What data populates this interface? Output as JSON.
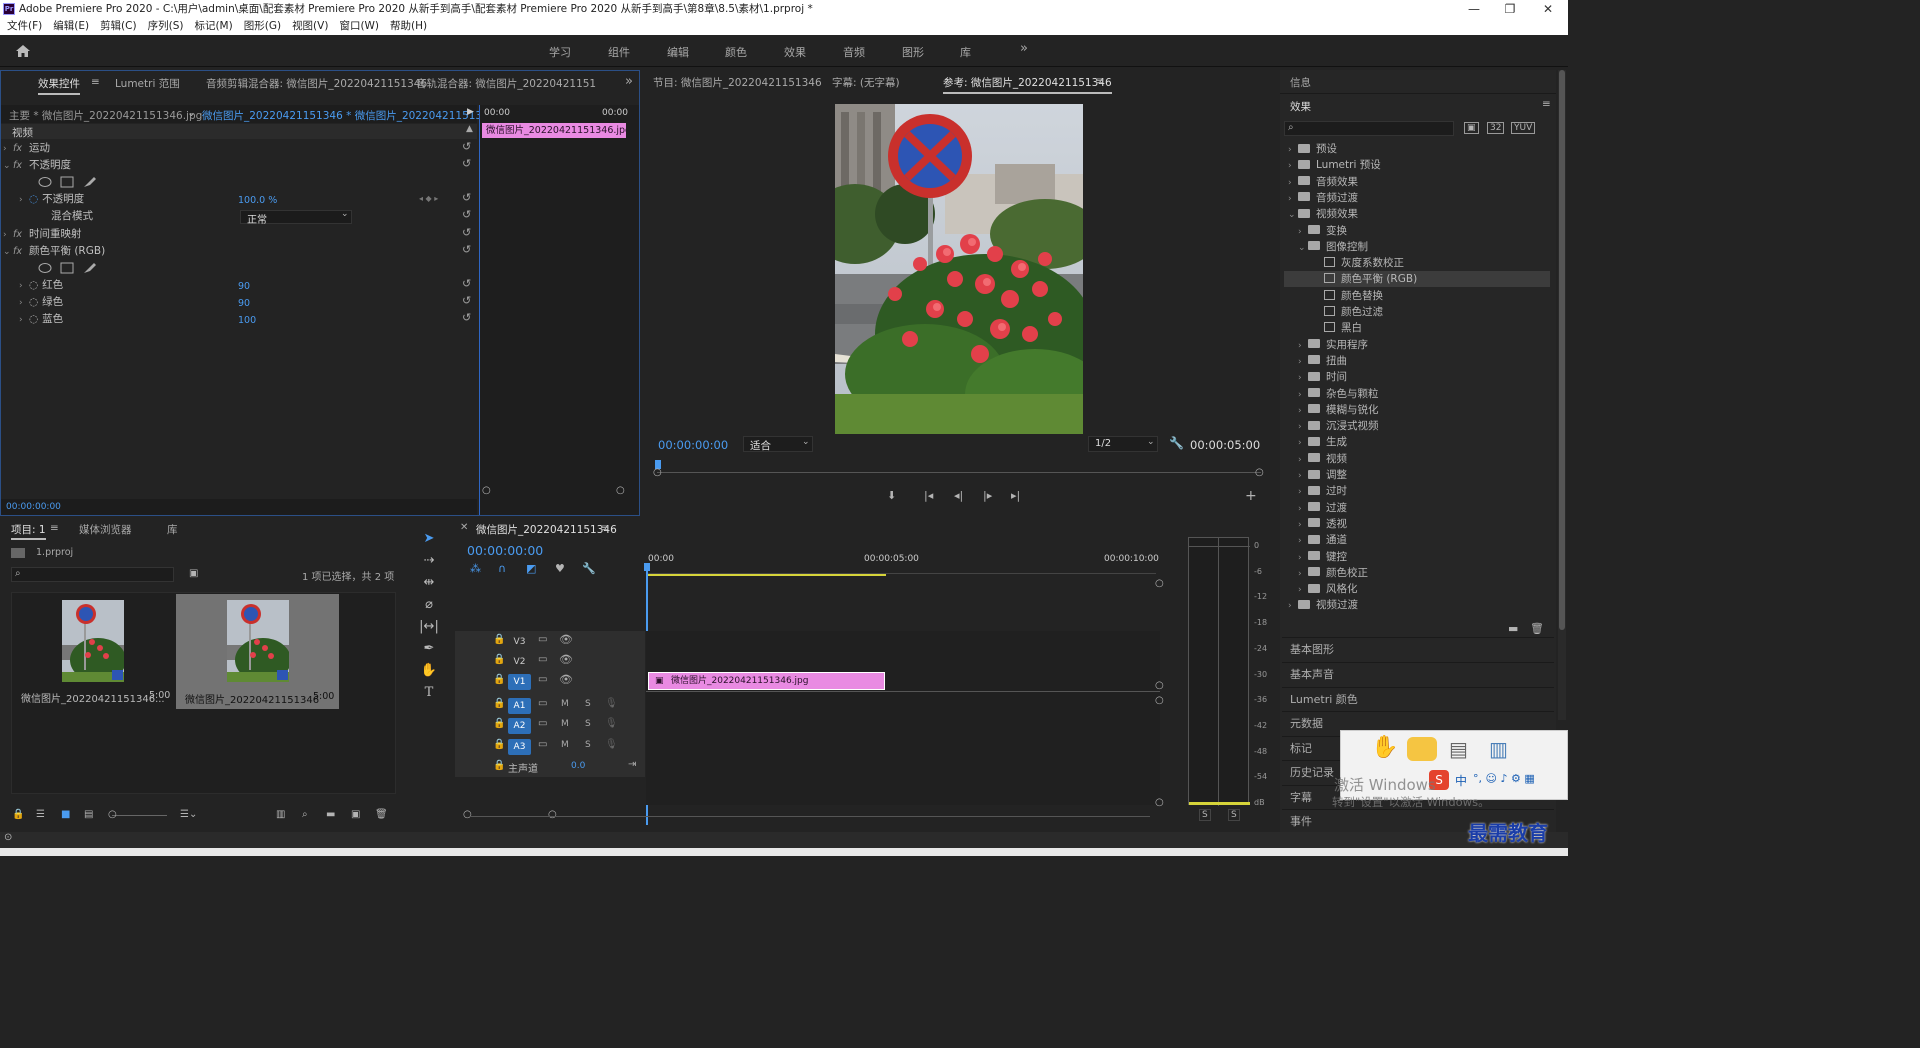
{
  "window": {
    "title": "Adobe Premiere Pro 2020 - C:\\用户\\admin\\桌面\\配套素材 Premiere Pro 2020 从新手到高手\\配套素材 Premiere Pro 2020 从新手到高手\\第8章\\8.5\\素材\\1.prproj *",
    "min": "—",
    "max": "❐",
    "close": "✕"
  },
  "menu": [
    "文件(F)",
    "编辑(E)",
    "剪辑(C)",
    "序列(S)",
    "标记(M)",
    "图形(G)",
    "视图(V)",
    "窗口(W)",
    "帮助(H)"
  ],
  "workspaces": [
    "学习",
    "组件",
    "编辑",
    "颜色",
    "效果",
    "音频",
    "图形",
    "库"
  ],
  "ws_more": "»",
  "left_tabs": [
    "效果控件",
    "Lumetri 范围",
    "音频剪辑混合器: 微信图片_20220421151346",
    "音轨混合器: 微信图片_20220421151"
  ],
  "effect_controls": {
    "master": "主要 * 微信图片_20220421151346.jpg",
    "sequence": "微信图片_20220421151346 * 微信图片_20220421151346...",
    "time_start": "00:00",
    "time_end": "00:00",
    "clip": "微信图片_20220421151346.jpg",
    "section": "视频",
    "rows": [
      "运动",
      "不透明度",
      "不透明度",
      "混合模式",
      "时间重映射",
      "颜色平衡 (RGB)",
      "红色",
      "绿色",
      "蓝色"
    ],
    "opacity_value": "100.0 %",
    "blend_value": "正常",
    "red": "90",
    "green": "90",
    "blue": "100",
    "footer_time": "00:00:00:00"
  },
  "monitor": {
    "tabs": [
      "节目: 微信图片_20220421151346",
      "字幕: (无字幕)",
      "参考: 微信图片_20220421151346"
    ],
    "timecode": "00:00:00:00",
    "fit": "适合",
    "quality": "1/2",
    "duration": "00:00:05:00"
  },
  "project": {
    "tabs": [
      "项目: 1",
      "媒体浏览器",
      "库"
    ],
    "file": "1.prproj",
    "selection": "1 项已选择，共 2 项",
    "items": [
      {
        "name": "微信图片_20220421151346...",
        "duration": "5:00"
      },
      {
        "name": "微信图片_20220421151346",
        "duration": "5:00"
      }
    ]
  },
  "timeline": {
    "title": "微信图片_20220421151346",
    "timecode": "00:00:00:00",
    "ruler": [
      "00:00",
      "00:00:05:00",
      "00:00:10:00"
    ],
    "tracks": [
      "V3",
      "V2",
      "V1",
      "A1",
      "A2",
      "A3"
    ],
    "master": "主声道",
    "master_value": "0.0",
    "clip": "微信图片_20220421151346.jpg"
  },
  "meter": {
    "labels": [
      "0",
      "-6",
      "-12",
      "-18",
      "-24",
      "-30",
      "-36",
      "-42",
      "-48",
      "-54",
      "dB"
    ],
    "solo": "S"
  },
  "right": {
    "info": "信息",
    "effects": "效果",
    "tree": [
      {
        "label": "预设",
        "level": 0,
        "open": false
      },
      {
        "label": "Lumetri 预设",
        "level": 0,
        "open": false
      },
      {
        "label": "音频效果",
        "level": 0,
        "open": false
      },
      {
        "label": "音频过渡",
        "level": 0,
        "open": false
      },
      {
        "label": "视频效果",
        "level": 0,
        "open": true
      },
      {
        "label": "变换",
        "level": 1,
        "open": false
      },
      {
        "label": "图像控制",
        "level": 1,
        "open": true
      },
      {
        "label": "灰度系数校正",
        "level": 2,
        "open": false
      },
      {
        "label": "颜色平衡 (RGB)",
        "level": 2,
        "open": false
      },
      {
        "label": "颜色替换",
        "level": 2,
        "open": false
      },
      {
        "label": "颜色过滤",
        "level": 2,
        "open": false
      },
      {
        "label": "黑白",
        "level": 2,
        "open": false
      },
      {
        "label": "实用程序",
        "level": 1,
        "open": false
      },
      {
        "label": "扭曲",
        "level": 1,
        "open": false
      },
      {
        "label": "时间",
        "level": 1,
        "open": false
      },
      {
        "label": "杂色与颗粒",
        "level": 1,
        "open": false
      },
      {
        "label": "模糊与锐化",
        "level": 1,
        "open": false
      },
      {
        "label": "沉浸式视频",
        "level": 1,
        "open": false
      },
      {
        "label": "生成",
        "level": 1,
        "open": false
      },
      {
        "label": "视频",
        "level": 1,
        "open": false
      },
      {
        "label": "调整",
        "level": 1,
        "open": false
      },
      {
        "label": "过时",
        "level": 1,
        "open": false
      },
      {
        "label": "过渡",
        "level": 1,
        "open": false
      },
      {
        "label": "透视",
        "level": 1,
        "open": false
      },
      {
        "label": "通道",
        "level": 1,
        "open": false
      },
      {
        "label": "键控",
        "level": 1,
        "open": false
      },
      {
        "label": "颜色校正",
        "level": 1,
        "open": false
      },
      {
        "label": "风格化",
        "level": 1,
        "open": false
      },
      {
        "label": "视频过渡",
        "level": 0,
        "open": false
      }
    ],
    "panels": [
      "基本图形",
      "基本声音",
      "Lumetri 颜色",
      "元数据",
      "标记",
      "历史记录",
      "字幕",
      "事件"
    ]
  },
  "watermark": {
    "line1": "激活 Windows",
    "line2": "转到\"设置\"以激活 Windows。",
    "brand": "最需教育",
    "ime": "中"
  }
}
